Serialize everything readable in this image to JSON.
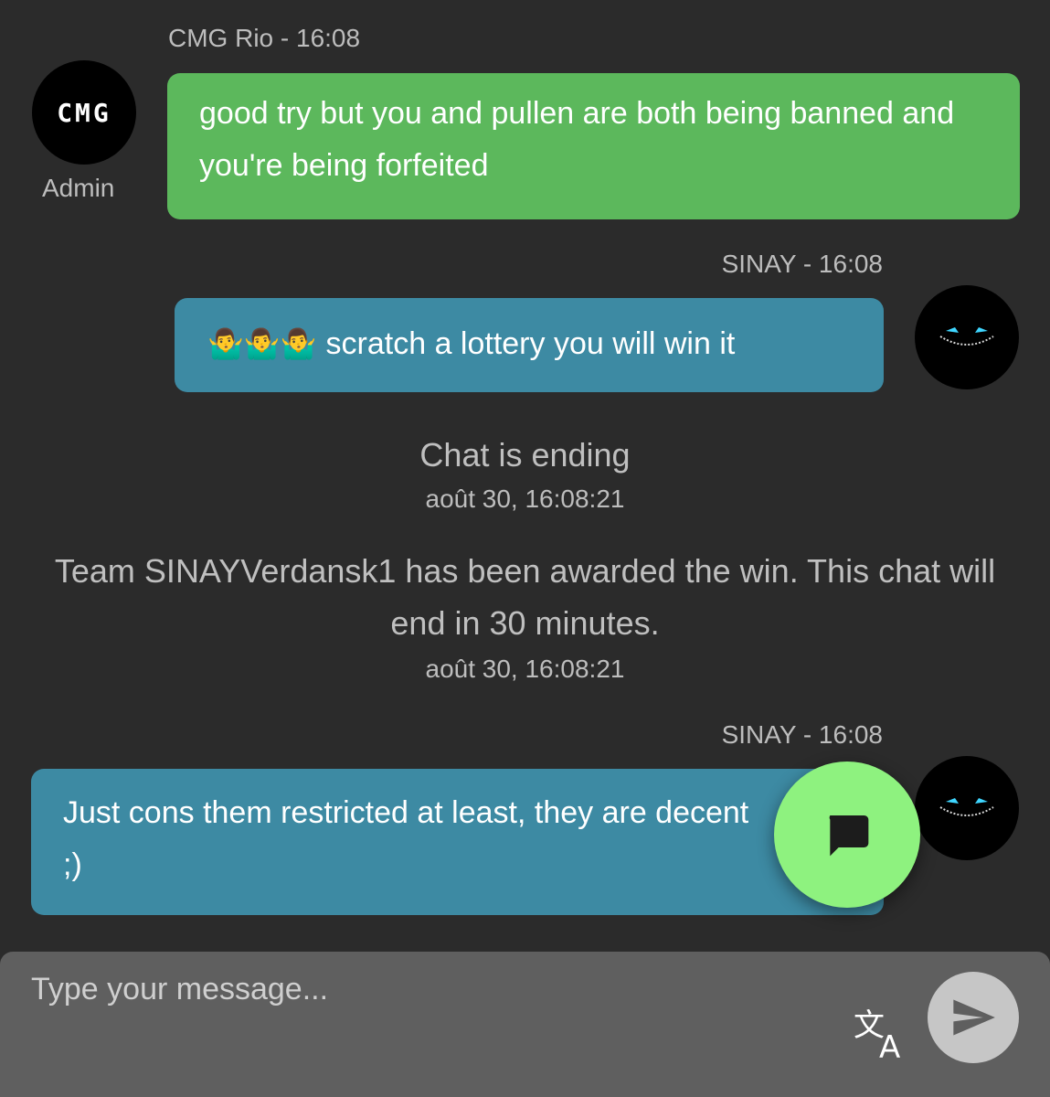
{
  "messages": [
    {
      "sender_line": "CMG Rio - 16:08",
      "text": "good try but you and pullen are both being banned and you're being forfeited",
      "role": "Admin",
      "avatar_text": "CMG"
    },
    {
      "sender_line": "SINAY - 16:08",
      "emojis": "🤷‍♂️🤷‍♂️🤷‍♂️",
      "text": "scratch a lottery you will win it"
    },
    {
      "sender_line": "SINAY - 16:08",
      "text": "Just cons them restricted at least, they are decent ;)"
    }
  ],
  "system": [
    {
      "text": "Chat is ending",
      "time": "août 30, 16:08:21"
    },
    {
      "text": "Team SINAYVerdansk1 has been awarded the win. This chat will end in 30 minutes.",
      "time": "août 30, 16:08:21"
    }
  ],
  "composer": {
    "placeholder": "Type your message...",
    "translate_icon": "translate-icon",
    "send_icon": "send-icon"
  },
  "fab_icon": "chat-bubble-icon",
  "colors": {
    "background": "#2b2b2b",
    "admin_bubble": "#5cb85c",
    "user_bubble": "#3d8aa3",
    "fab": "#8ef27f"
  }
}
